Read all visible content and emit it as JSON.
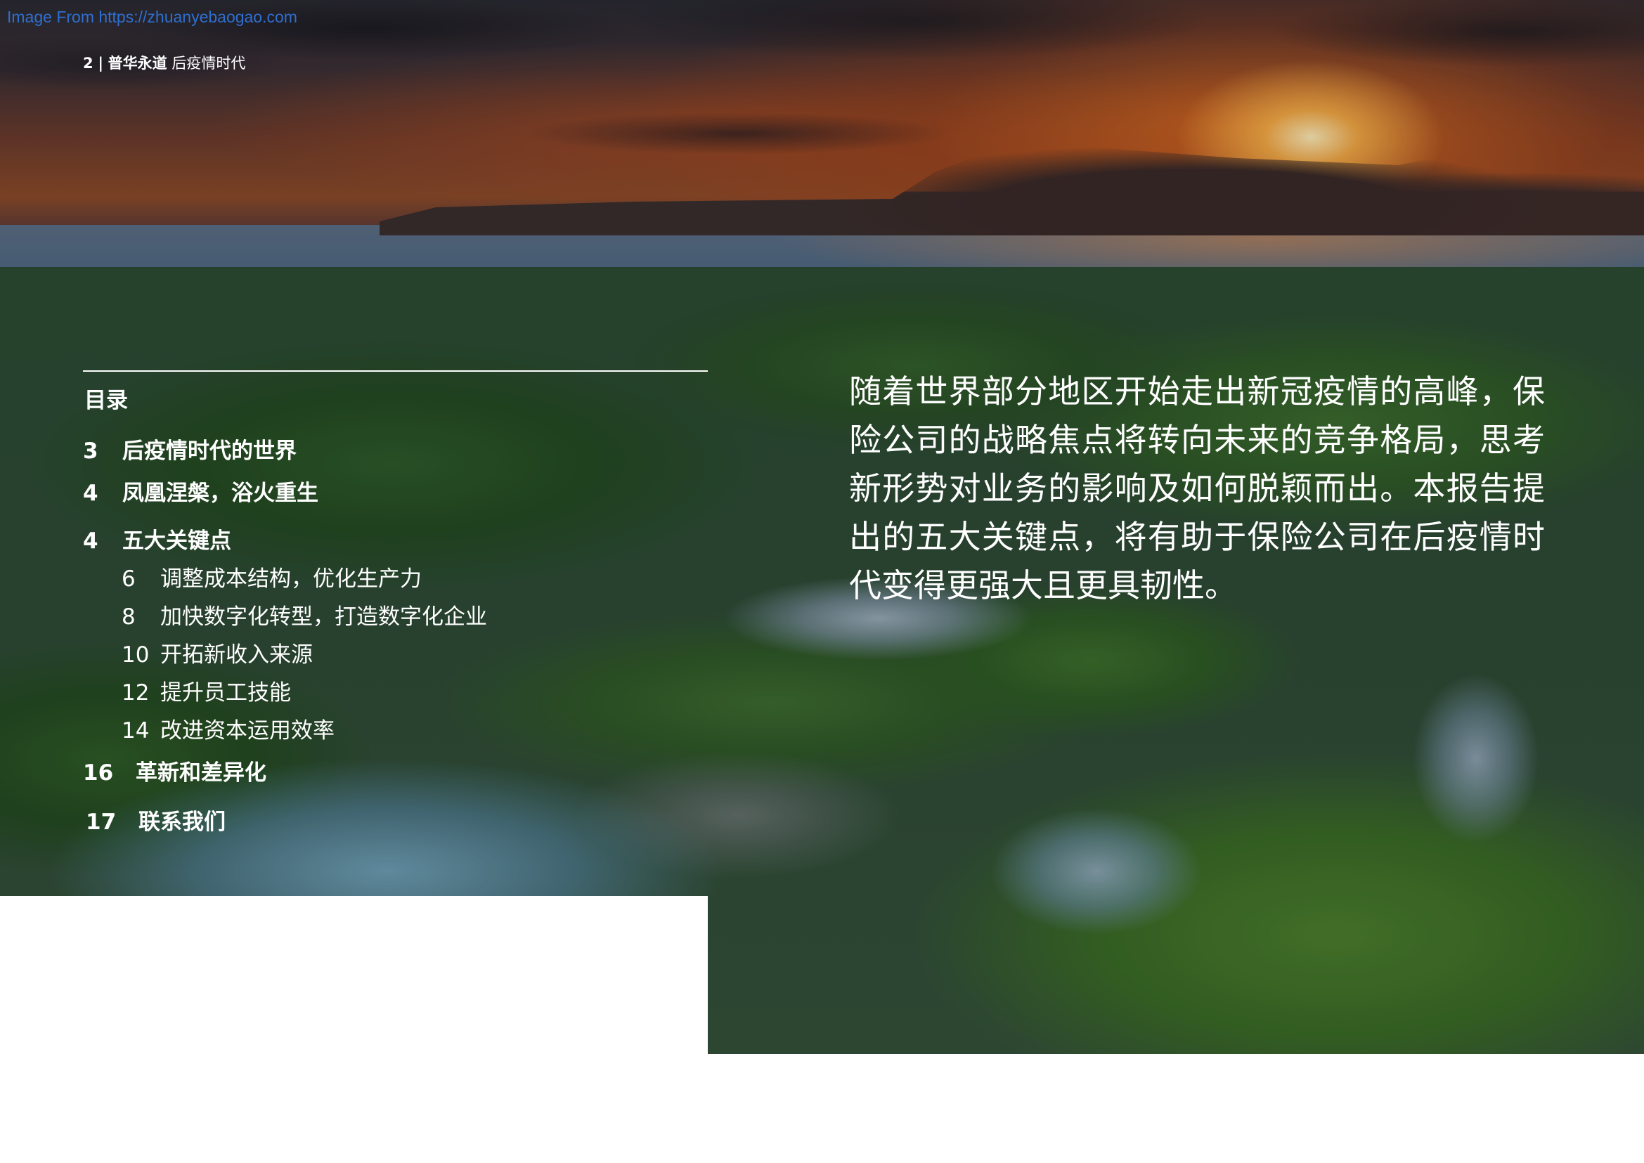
{
  "watermark": "Image From https://zhuanyebaogao.com",
  "header": {
    "page_number": "2",
    "separator": "|",
    "brand": "普华永道",
    "section": "后疫情时代"
  },
  "toc": {
    "heading": "目录",
    "items": [
      {
        "page": "3",
        "title": "后疫情时代的世界",
        "level": 1
      },
      {
        "page": "4",
        "title": "凤凰涅槃，浴火重生",
        "level": 1
      },
      {
        "page": "4",
        "title": "五大关键点",
        "level": 1
      },
      {
        "page": "6",
        "title": "调整成本结构，优化生产力",
        "level": 2
      },
      {
        "page": "8",
        "title": "加快数字化转型，打造数字化企业",
        "level": 2
      },
      {
        "page": "10",
        "title": "开拓新收入来源",
        "level": 2
      },
      {
        "page": "12",
        "title": "提升员工技能",
        "level": 2
      },
      {
        "page": "14",
        "title": "改进资本运用效率",
        "level": 2
      },
      {
        "page": "16",
        "title": "革新和差异化",
        "level": 1
      },
      {
        "page": "17",
        "title": "联系我们",
        "level": 1
      }
    ]
  },
  "intro": "随着世界部分地区开始走出新冠疫情的高峰，保险公司的战略焦点将转向未来的竞争格局，思考新形势对业务的影响及如何脱颖而出。本报告提出的五大关键点，将有助于保险公司在后疫情时代变得更强大且更具韧性。",
  "colors": {
    "watermark_link": "#2f6fd0",
    "text_on_photo": "#ffffff",
    "page_background": "#ffffff"
  }
}
